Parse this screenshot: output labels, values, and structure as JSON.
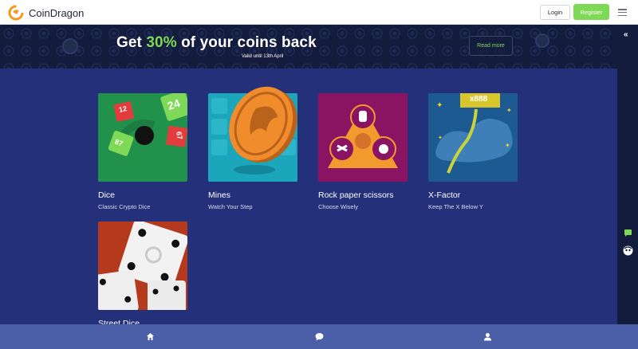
{
  "brand": {
    "name": "CoinDragon"
  },
  "header": {
    "login_label": "Login",
    "register_label": "Register"
  },
  "banner": {
    "title_prefix": "Get ",
    "title_highlight": "30%",
    "title_suffix": " of your coins back",
    "subtitle": "Valid until 13th April",
    "cta_label": "Read more"
  },
  "games": [
    {
      "title": "Dice",
      "subtitle": "Classic Crypto Dice",
      "dice_labels": [
        "12",
        "24",
        "87",
        "67"
      ]
    },
    {
      "title": "Mines",
      "subtitle": "Watch Your Step"
    },
    {
      "title": "Rock paper scissors",
      "subtitle": "Choose Wisely"
    },
    {
      "title": "X-Factor",
      "subtitle": "Keep The X Below Y",
      "badge": "x888"
    },
    {
      "title": "Street Dice",
      "subtitle": ""
    }
  ],
  "colors": {
    "accent": "#7ed957",
    "background": "#24307a",
    "banner": "#141c3e",
    "bottom_nav": "#4a5fa8"
  },
  "icons": {
    "collapse": "double-chevron-left-icon",
    "chat": "chat-bubble-icon",
    "support": "support-avatar-icon",
    "home": "home-icon",
    "user": "user-icon"
  }
}
